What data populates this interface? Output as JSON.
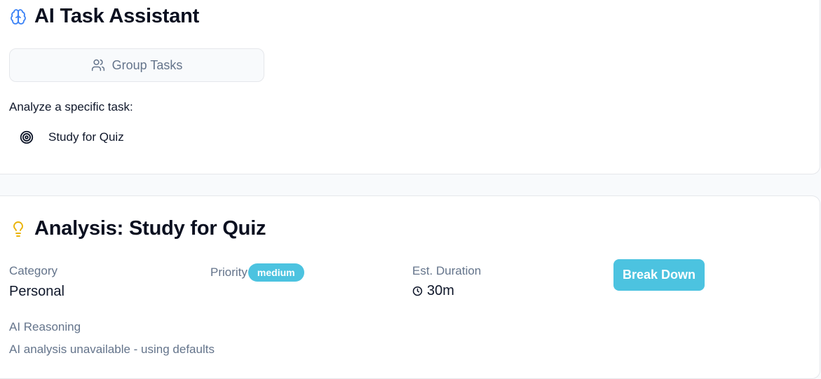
{
  "assistant": {
    "title": "AI Task Assistant",
    "title_icon": "brain-icon",
    "group_tasks_label": "Group Tasks",
    "group_icon": "users-icon",
    "analyze_label": "Analyze a specific task:",
    "tasks": [
      {
        "label": "Study for Quiz",
        "icon": "target-icon"
      }
    ]
  },
  "analysis": {
    "title": "Analysis: Study for Quiz",
    "title_icon": "lightbulb-icon",
    "category_label": "Category",
    "category_value": "Personal",
    "priority_label": "Priority",
    "priority_value": "medium",
    "duration_label": "Est. Duration",
    "duration_value": "30m",
    "duration_icon": "clock-icon",
    "break_down_label": "Break Down",
    "reasoning_label": "AI Reasoning",
    "reasoning_text": "AI analysis unavailable - using defaults"
  },
  "colors": {
    "accent": "#4cc3e0",
    "brain_icon": "#3b82f6",
    "lightbulb_icon": "#eab308",
    "muted_text": "#64748b"
  }
}
